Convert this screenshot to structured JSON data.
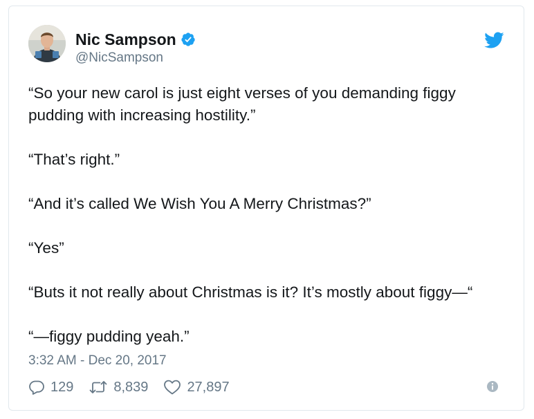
{
  "user": {
    "name": "Nic Sampson",
    "handle": "@NicSampson",
    "verified": true
  },
  "tweet": {
    "paragraphs": [
      "“So your new carol is just eight verses of you demanding figgy pudding with increasing hostility.”",
      "“That’s right.”",
      "“And it’s called We Wish You A Merry Christmas?”",
      "“Yes”",
      "“Buts it not really about Christmas is it? It’s mostly about figgy—“",
      "“—figgy pudding yeah.”"
    ],
    "timestamp": "3:32 AM - Dec 20, 2017"
  },
  "actions": {
    "replies": "129",
    "retweets": "8,839",
    "likes": "27,897"
  },
  "icons": {
    "verified": "verified-badge-icon",
    "brand": "twitter-bird-icon",
    "reply": "reply-icon",
    "retweet": "retweet-icon",
    "like": "heart-icon",
    "info": "info-icon"
  },
  "colors": {
    "brand_blue": "#1da1f2",
    "text": "#14171a",
    "secondary_text": "#657786",
    "border": "#e1e8ed"
  }
}
